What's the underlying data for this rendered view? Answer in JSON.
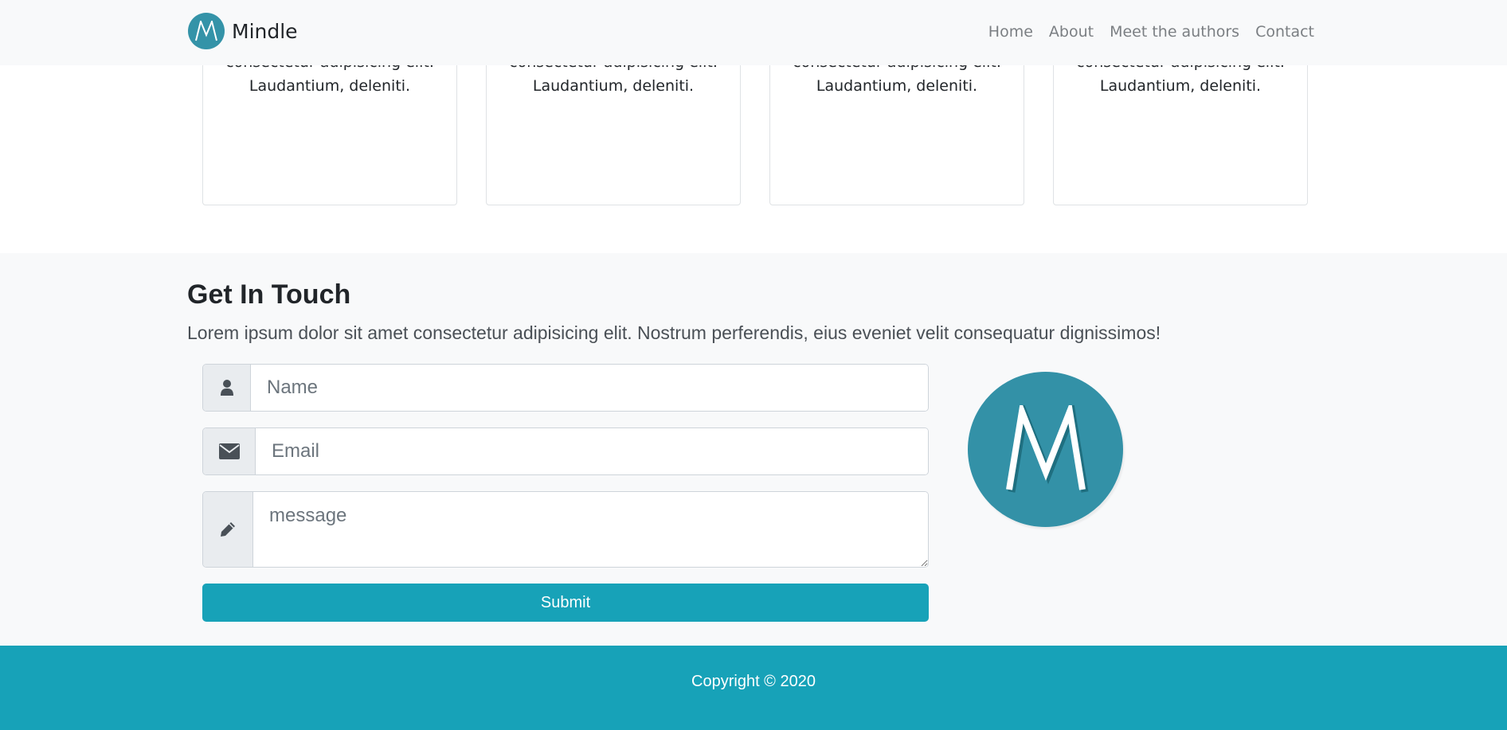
{
  "navbar": {
    "brand": {
      "logo_letter": "M",
      "name": "Mindle"
    },
    "links": [
      "Home",
      "About",
      "Meet the authors",
      "Contact"
    ]
  },
  "cards": [
    {
      "text_cut": "consectetur adipisicing elit.",
      "text": "Laudantium, deleniti."
    },
    {
      "text_cut": "consectetur adipisicing elit.",
      "text": "Laudantium, deleniti."
    },
    {
      "text_cut": "consectetur adipisicing elit.",
      "text": "Laudantium, deleniti."
    },
    {
      "text_cut": "consectetur adipisicing elit.",
      "text": "Laudantium, deleniti."
    }
  ],
  "contact": {
    "title": "Get In Touch",
    "lead": "Lorem ipsum dolor sit amet consectetur adipisicing elit. Nostrum perferendis, eius eveniet velit consequatur dignissimos!",
    "name_placeholder": "Name",
    "email_placeholder": "Email",
    "message_placeholder": "message",
    "name_icon": "user-icon",
    "email_icon": "envelope-icon",
    "message_icon": "pencil-icon",
    "submit_label": "Submit",
    "logo_letter": "M"
  },
  "footer": {
    "copyright": "Copyright © 2020"
  },
  "colors": {
    "accent": "#17a2b8",
    "logo": "#3391a7",
    "light_bg": "#f8f9fa"
  }
}
